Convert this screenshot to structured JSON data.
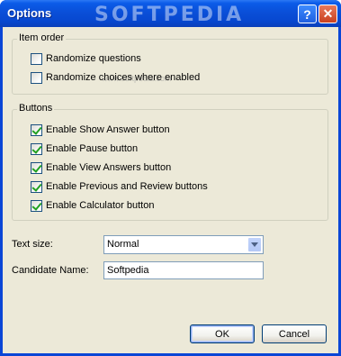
{
  "window": {
    "title": "Options",
    "watermark": "SOFTPEDIA",
    "watermark_sub": "www.softpedia.com",
    "help_glyph": "?",
    "close_glyph": "✕"
  },
  "item_order": {
    "legend": "Item order",
    "options": [
      {
        "label": "Randomize questions",
        "checked": false
      },
      {
        "label": "Randomize choices where enabled",
        "checked": false
      }
    ]
  },
  "buttons_group": {
    "legend": "Buttons",
    "options": [
      {
        "label": "Enable Show Answer button",
        "checked": true
      },
      {
        "label": "Enable Pause button",
        "checked": true
      },
      {
        "label": "Enable View Answers button",
        "checked": true
      },
      {
        "label": "Enable Previous and Review buttons",
        "checked": true
      },
      {
        "label": "Enable Calculator button",
        "checked": true
      }
    ]
  },
  "text_size": {
    "label": "Text size:",
    "value": "Normal"
  },
  "candidate_name": {
    "label": "Candidate Name:",
    "value": "Softpedia"
  },
  "actions": {
    "ok": "OK",
    "cancel": "Cancel"
  },
  "colors": {
    "title_bar": "#0a4fd8",
    "client_bg": "#ece9d8",
    "check_mark": "#21a121"
  }
}
